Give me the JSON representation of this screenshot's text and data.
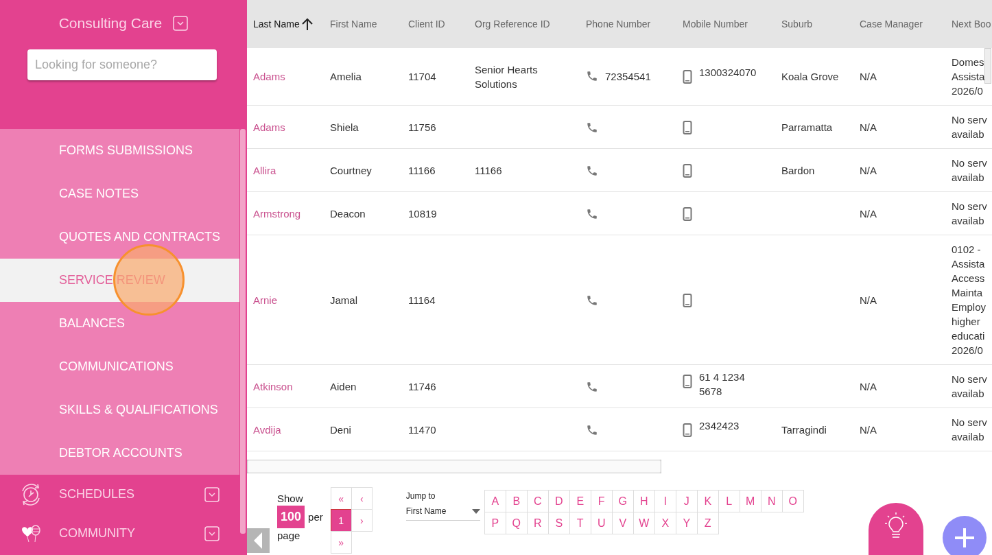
{
  "sidebar": {
    "org_name": "Consulting Care",
    "search": {
      "placeholder": "Looking for someone?"
    },
    "submenu": [
      {
        "label": "FORMS SUBMISSIONS",
        "selected": false,
        "click_marker": false
      },
      {
        "label": "CASE NOTES",
        "selected": false,
        "click_marker": false
      },
      {
        "label": "QUOTES AND CONTRACTS",
        "selected": false,
        "click_marker": false
      },
      {
        "label": "SERVICE REVIEW",
        "selected": true,
        "click_marker": true
      },
      {
        "label": "BALANCES",
        "selected": false,
        "click_marker": false
      },
      {
        "label": "COMMUNICATIONS",
        "selected": false,
        "click_marker": false
      },
      {
        "label": "SKILLS & QUALIFICATIONS",
        "selected": false,
        "click_marker": false
      },
      {
        "label": "DEBTOR ACCOUNTS",
        "selected": false,
        "click_marker": false
      }
    ],
    "sections": [
      {
        "label": "SCHEDULES",
        "kind": "clock",
        "expanded": false
      },
      {
        "label": "COMMUNITY",
        "kind": "hearts",
        "expanded": false
      }
    ]
  },
  "table": {
    "columns": [
      {
        "label": "Last Name",
        "sorted": true
      },
      {
        "label": "First Name",
        "sorted": false
      },
      {
        "label": "Client ID",
        "sorted": false
      },
      {
        "label": "Org Reference ID",
        "sorted": false
      },
      {
        "label": "Phone Number",
        "sorted": false
      },
      {
        "label": "Mobile Number",
        "sorted": false
      },
      {
        "label": "Suburb",
        "sorted": false
      },
      {
        "label": "Case Manager",
        "sorted": false
      },
      {
        "label": "Next Boo",
        "sorted": false
      }
    ],
    "rows": [
      {
        "last_name": "Adams",
        "first_name": "Amelia",
        "client_id": "11704",
        "org_reference_id": "Senior Hearts Solutions",
        "phone": "72354541",
        "mobile": "1300324070",
        "suburb": "Koala Grove",
        "case_manager": "N/A",
        "next_booking": [
          "Domes",
          "Assista",
          "2026/0"
        ]
      },
      {
        "last_name": "Adams",
        "first_name": "Shiela",
        "client_id": "11756",
        "org_reference_id": "",
        "phone": "",
        "mobile": "",
        "suburb": "Parramatta",
        "case_manager": "N/A",
        "next_booking": [
          "No serv",
          "availab"
        ]
      },
      {
        "last_name": "Allira",
        "first_name": "Courtney",
        "client_id": "11166",
        "org_reference_id": "11166",
        "phone": "",
        "mobile": "",
        "suburb": "Bardon",
        "case_manager": "N/A",
        "next_booking": [
          "No serv",
          "availab"
        ]
      },
      {
        "last_name": "Armstrong",
        "first_name": "Deacon",
        "client_id": "10819",
        "org_reference_id": "",
        "phone": "",
        "mobile": "",
        "suburb": "",
        "case_manager": "N/A",
        "next_booking": [
          "No serv",
          "availab"
        ]
      },
      {
        "last_name": "Arnie",
        "first_name": "Jamal",
        "client_id": "11164",
        "org_reference_id": "",
        "phone": "",
        "mobile": "",
        "suburb": "",
        "case_manager": "N/A",
        "next_booking": [
          "0102 -",
          "Assista",
          "Access",
          "Mainta",
          "Employ",
          "higher",
          "educati",
          "2026/0"
        ]
      },
      {
        "last_name": "Atkinson",
        "first_name": "Aiden",
        "client_id": "11746",
        "org_reference_id": "",
        "phone": "",
        "mobile": "61 4 1234 5678",
        "suburb": "",
        "case_manager": "N/A",
        "next_booking": [
          "No serv",
          "availab"
        ]
      },
      {
        "last_name": "Avdija",
        "first_name": "Deni",
        "client_id": "11470",
        "org_reference_id": "",
        "phone": "",
        "mobile": "2342423",
        "suburb": "Tarragindi",
        "case_manager": "N/A",
        "next_booking": [
          "No serv",
          "availab"
        ]
      }
    ]
  },
  "pagination": {
    "show_label": "Show",
    "page_size": "100",
    "per_label": "per",
    "page_label": "page",
    "first": "«",
    "prev": "‹",
    "pages": [
      {
        "label": "1",
        "selected": true
      }
    ],
    "next": "›",
    "last": "»"
  },
  "jump_to": {
    "label": "Jump to",
    "field": "First Name",
    "letters": [
      [
        "A",
        "B",
        "C",
        "D",
        "E",
        "F",
        "G",
        "H",
        "I",
        "J",
        "K",
        "L",
        "M",
        "N",
        "O"
      ],
      [
        "P",
        "Q",
        "R",
        "S",
        "T",
        "U",
        "V",
        "W",
        "X",
        "Y",
        "Z"
      ]
    ]
  }
}
